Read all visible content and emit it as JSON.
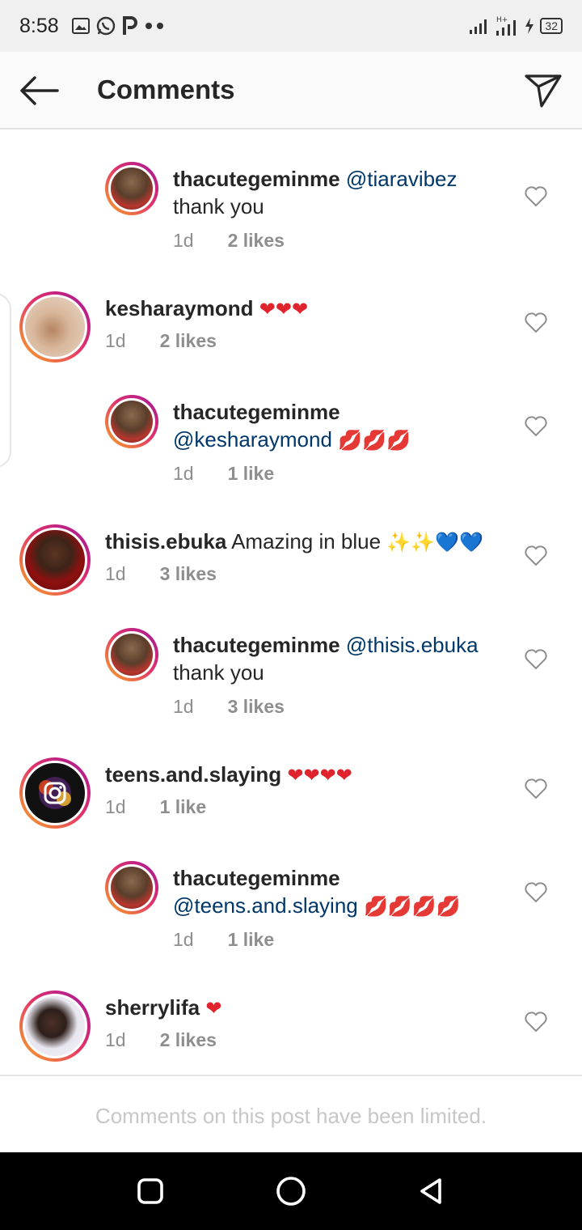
{
  "status_bar": {
    "time": "8:58",
    "battery": "32",
    "left_icons": [
      "image-icon",
      "whatsapp-icon",
      "p-icon",
      "more-dots-icon"
    ],
    "right_icons": [
      "signal-icon",
      "h-plus-signal-icon",
      "charging-icon",
      "battery-icon"
    ]
  },
  "header": {
    "title": "Comments",
    "back_icon": "arrow-left-icon",
    "share_icon": "send-icon"
  },
  "comments": [
    {
      "username": "thacutegeminme",
      "mention": "@tiaravibez",
      "text": "thank you",
      "emoji": "",
      "age": "1d",
      "likes": "2 likes",
      "reply": true
    },
    {
      "username": "kesharaymond",
      "mention": "",
      "text": "",
      "emoji": "❤❤❤",
      "age": "1d",
      "likes": "2 likes",
      "reply": false
    },
    {
      "username": "thacutegeminme",
      "mention": "@kesharaymond",
      "text": "",
      "emoji": "💋💋💋",
      "age": "1d",
      "likes": "1 like",
      "reply": true
    },
    {
      "username": "thisis.ebuka",
      "mention": "",
      "text": "Amazing in blue",
      "emoji": "✨✨💙💙",
      "age": "1d",
      "likes": "3 likes",
      "reply": false
    },
    {
      "username": "thacutegeminme",
      "mention": "@thisis.ebuka",
      "text": "thank you",
      "emoji": "",
      "age": "1d",
      "likes": "3 likes",
      "reply": true
    },
    {
      "username": "teens.and.slaying",
      "mention": "",
      "text": "",
      "emoji": "❤❤❤❤",
      "age": "1d",
      "likes": "1 like",
      "reply": false
    },
    {
      "username": "thacutegeminme",
      "mention": "@teens.and.slaying",
      "text": "",
      "emoji": "💋💋💋💋",
      "age": "1d",
      "likes": "1 like",
      "reply": true
    },
    {
      "username": "sherrylifa",
      "mention": "",
      "text": "",
      "emoji": "❤",
      "age": "1d",
      "likes": "2 likes",
      "reply": false
    }
  ],
  "footer": {
    "limited_text": "Comments on this post have been limited."
  },
  "nav": {
    "icons": [
      "recents-icon",
      "home-icon",
      "back-icon"
    ]
  },
  "colors": {
    "mention": "#00376b",
    "meta": "#8e8e8e",
    "heart_emoji": "#e0242d"
  }
}
